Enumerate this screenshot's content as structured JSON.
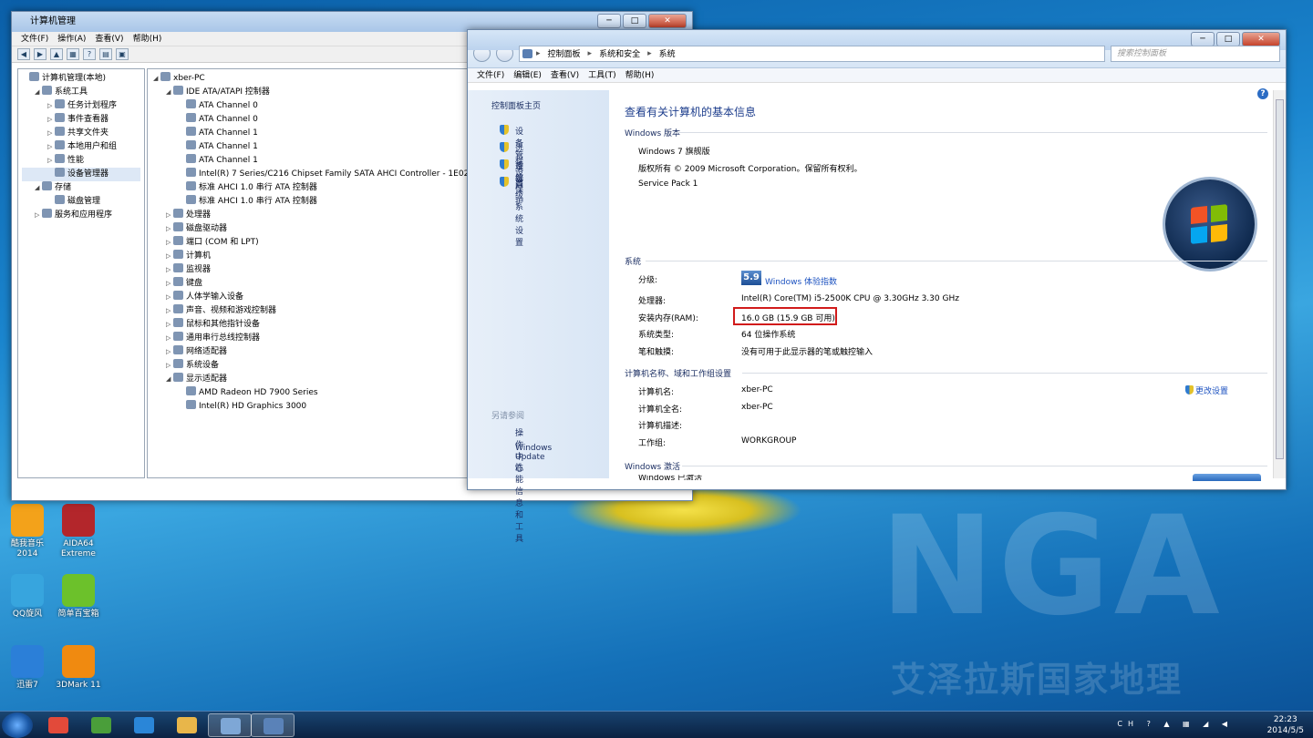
{
  "watermark": {
    "logo": "NGA",
    "cn": "艾泽拉斯国家地理"
  },
  "desktop": {
    "icons": [
      {
        "label": "酷我音乐\n2014",
        "color": "#f3a21a"
      },
      {
        "label": "AIDA64\nExtreme",
        "color": "#b3262b"
      },
      {
        "label": "QQ旋风",
        "color": "#37a5de"
      },
      {
        "label": "简单百宝箱",
        "color": "#6cc12b"
      },
      {
        "label": "迅雷7",
        "color": "#2b7fd8"
      },
      {
        "label": "3DMark 11",
        "color": "#f08a10"
      }
    ]
  },
  "cm": {
    "title": "计算机管理",
    "menu": [
      "文件(F)",
      "操作(A)",
      "查看(V)",
      "帮助(H)"
    ],
    "btns": {
      "min": "─",
      "max": "□",
      "close": "✕"
    },
    "toolbar": [
      "◀",
      "▶",
      "▲",
      "▦",
      "?",
      "▤",
      "▣"
    ],
    "left_tree": [
      {
        "text": "计算机管理(本地)",
        "level": 0,
        "exp": ""
      },
      {
        "text": "系统工具",
        "level": 1,
        "exp": "◢"
      },
      {
        "text": "任务计划程序",
        "level": 2,
        "exp": "▷"
      },
      {
        "text": "事件查看器",
        "level": 2,
        "exp": "▷"
      },
      {
        "text": "共享文件夹",
        "level": 2,
        "exp": "▷"
      },
      {
        "text": "本地用户和组",
        "level": 2,
        "exp": "▷"
      },
      {
        "text": "性能",
        "level": 2,
        "exp": "▷"
      },
      {
        "text": "设备管理器",
        "level": 2,
        "exp": "",
        "sel": true
      },
      {
        "text": "存储",
        "level": 1,
        "exp": "◢"
      },
      {
        "text": "磁盘管理",
        "level": 2,
        "exp": ""
      },
      {
        "text": "服务和应用程序",
        "level": 1,
        "exp": "▷"
      }
    ],
    "right_tree": [
      {
        "text": "xber-PC",
        "level": 0,
        "exp": "◢"
      },
      {
        "text": "IDE ATA/ATAPI 控制器",
        "level": 1,
        "exp": "◢"
      },
      {
        "text": "ATA Channel 0",
        "level": 2,
        "exp": ""
      },
      {
        "text": "ATA Channel 0",
        "level": 2,
        "exp": ""
      },
      {
        "text": "ATA Channel 1",
        "level": 2,
        "exp": ""
      },
      {
        "text": "ATA Channel 1",
        "level": 2,
        "exp": ""
      },
      {
        "text": "ATA Channel 1",
        "level": 2,
        "exp": ""
      },
      {
        "text": "Intel(R) 7 Series/C216 Chipset Family SATA AHCI Controller - 1E02",
        "level": 2,
        "exp": ""
      },
      {
        "text": "标准 AHCI 1.0 串行 ATA 控制器",
        "level": 2,
        "exp": ""
      },
      {
        "text": "标准 AHCI 1.0 串行 ATA 控制器",
        "level": 2,
        "exp": ""
      },
      {
        "text": "处理器",
        "level": 1,
        "exp": "▷"
      },
      {
        "text": "磁盘驱动器",
        "level": 1,
        "exp": "▷"
      },
      {
        "text": "端口 (COM 和 LPT)",
        "level": 1,
        "exp": "▷"
      },
      {
        "text": "计算机",
        "level": 1,
        "exp": "▷"
      },
      {
        "text": "监视器",
        "level": 1,
        "exp": "▷"
      },
      {
        "text": "键盘",
        "level": 1,
        "exp": "▷"
      },
      {
        "text": "人体学输入设备",
        "level": 1,
        "exp": "▷"
      },
      {
        "text": "声音、视频和游戏控制器",
        "level": 1,
        "exp": "▷"
      },
      {
        "text": "鼠标和其他指针设备",
        "level": 1,
        "exp": "▷"
      },
      {
        "text": "通用串行总线控制器",
        "level": 1,
        "exp": "▷"
      },
      {
        "text": "网络适配器",
        "level": 1,
        "exp": "▷"
      },
      {
        "text": "系统设备",
        "level": 1,
        "exp": "▷"
      },
      {
        "text": "显示适配器",
        "level": 1,
        "exp": "◢"
      },
      {
        "text": "AMD Radeon HD 7900 Series",
        "level": 2,
        "exp": ""
      },
      {
        "text": "Intel(R) HD Graphics 3000",
        "level": 2,
        "exp": ""
      }
    ]
  },
  "sys": {
    "btns": {
      "min": "─",
      "max": "□",
      "close": "✕"
    },
    "breadcrumb": [
      "控制面板",
      "系统和安全",
      "系统"
    ],
    "sep": "▸",
    "search_placeholder": "搜索控制面板",
    "menu": [
      "文件(F)",
      "编辑(E)",
      "查看(V)",
      "工具(T)",
      "帮助(H)"
    ],
    "left": {
      "home": "控制面板主页",
      "links": [
        "设备管理器",
        "远程设置",
        "系统保护",
        "高级系统设置"
      ],
      "see_also": "另请参阅",
      "also": [
        "操作中心",
        "Windows Update",
        "性能信息和工具"
      ]
    },
    "heading": "查看有关计算机的基本信息",
    "help": "?",
    "edition_title": "Windows 版本",
    "edition": [
      "Windows 7 旗舰版",
      "版权所有 © 2009 Microsoft Corporation。保留所有权利。",
      "Service Pack 1"
    ],
    "system_title": "系统",
    "rating_label": "分级:",
    "rating_score": "5.9",
    "rating_link": "Windows 体验指数",
    "rows": [
      {
        "k": "处理器:",
        "v": "Intel(R) Core(TM) i5-2500K CPU @ 3.30GHz   3.30 GHz"
      },
      {
        "k": "安装内存(RAM):",
        "v": "16.0 GB (15.9 GB 可用)"
      },
      {
        "k": "系统类型:",
        "v": "64 位操作系统"
      },
      {
        "k": "笔和触摸:",
        "v": "没有可用于此显示器的笔或触控输入"
      }
    ],
    "name_title": "计算机名称、域和工作组设置",
    "change": "更改设置",
    "rows2": [
      {
        "k": "计算机名:",
        "v": "xber-PC"
      },
      {
        "k": "计算机全名:",
        "v": "xber-PC"
      },
      {
        "k": "计算机描述:",
        "v": ""
      },
      {
        "k": "工作组:",
        "v": "WORKGROUP"
      }
    ],
    "activation_title": "Windows 激活",
    "activation_cut": "Windows 已激活",
    "highlight_color": "#d11b1b"
  },
  "taskbar": {
    "items": [
      {
        "color": "#e24a3a"
      },
      {
        "color": "#4a9e3a"
      },
      {
        "color": "#2a86d8"
      },
      {
        "color": "#e8b64a"
      },
      {
        "color": "#7ea7d6",
        "active": true
      },
      {
        "color": "#5a82b8",
        "active": true
      }
    ],
    "tray": "CH ? ▲ ▦ ◢ ◀",
    "time": "22:23",
    "date": "2014/5/5"
  }
}
